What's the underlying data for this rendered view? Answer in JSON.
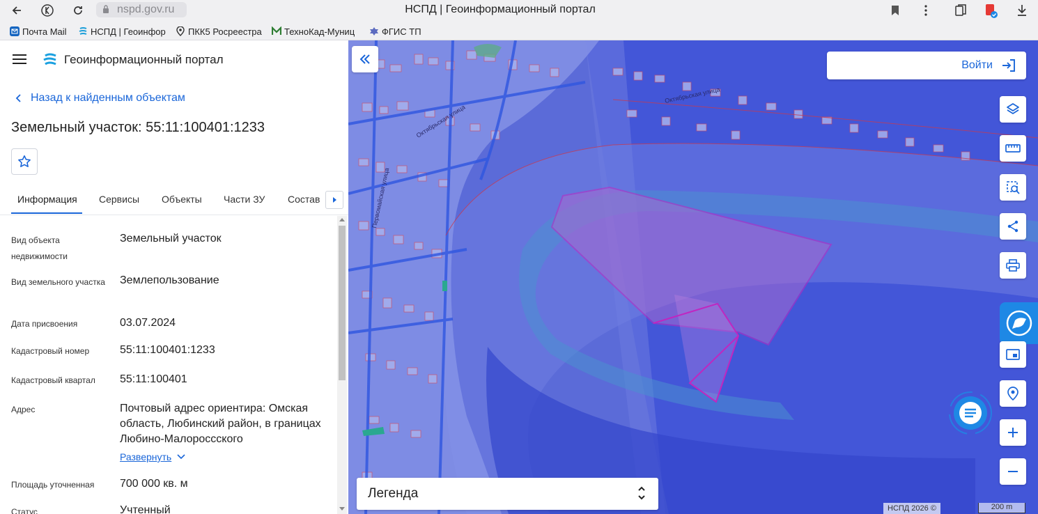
{
  "browser": {
    "url": "nspd.gov.ru",
    "tab_title": "НСПД | Геоинформационный портал",
    "bookmarks": [
      "Почта Mail",
      "НСПД | Геоинфор",
      "ПКК5 Росреестра",
      "ТехноКад-Муниц",
      "ФГИС ТП"
    ]
  },
  "panel": {
    "portal_title": "Геоинформационный портал",
    "back_label": "Назад к найденным объектам",
    "object_title": "Земельный участок: 55:11:100401:1233",
    "tabs": [
      "Информация",
      "Сервисы",
      "Объекты",
      "Части ЗУ",
      "Состав"
    ],
    "active_tab": "Информация",
    "rows": [
      {
        "label": "Вид объекта недвижимости",
        "value": "Земельный участок"
      },
      {
        "label": "Вид земельного участка",
        "value": "Землепользование"
      },
      {
        "label": "Дата присвоения",
        "value": "03.07.2024"
      },
      {
        "label": "Кадастровый номер",
        "value": "55:11:100401:1233"
      },
      {
        "label": "Кадастровый квартал",
        "value": "55:11:100401"
      },
      {
        "label": "Адрес",
        "value": "Почтовый адрес ориентира: Омская область, Любинский район, в границах Любино-Малороссского"
      },
      {
        "label": "Площадь уточненная",
        "value": "700 000 кв. м"
      },
      {
        "label": "Статус",
        "value": "Учтенный"
      }
    ],
    "expand_label": "Развернуть"
  },
  "map": {
    "login_label": "Войти",
    "legend_label": "Легенда",
    "copyright": "НСПД 2026 ©",
    "scale": "200 m",
    "street_labels": [
      "Октябрьская улица",
      "Первомайская улица",
      "Октябрьская улица"
    ],
    "tools": [
      "layers-icon",
      "ruler-icon",
      "select-area-icon",
      "share-icon",
      "print-icon",
      "minimap-icon",
      "geolocation-icon",
      "zoom-in-icon",
      "zoom-out-icon"
    ],
    "colors": {
      "water": "#5a6ad8",
      "parcel_outline": "#c026c0",
      "accent": "#1a66d9"
    }
  }
}
